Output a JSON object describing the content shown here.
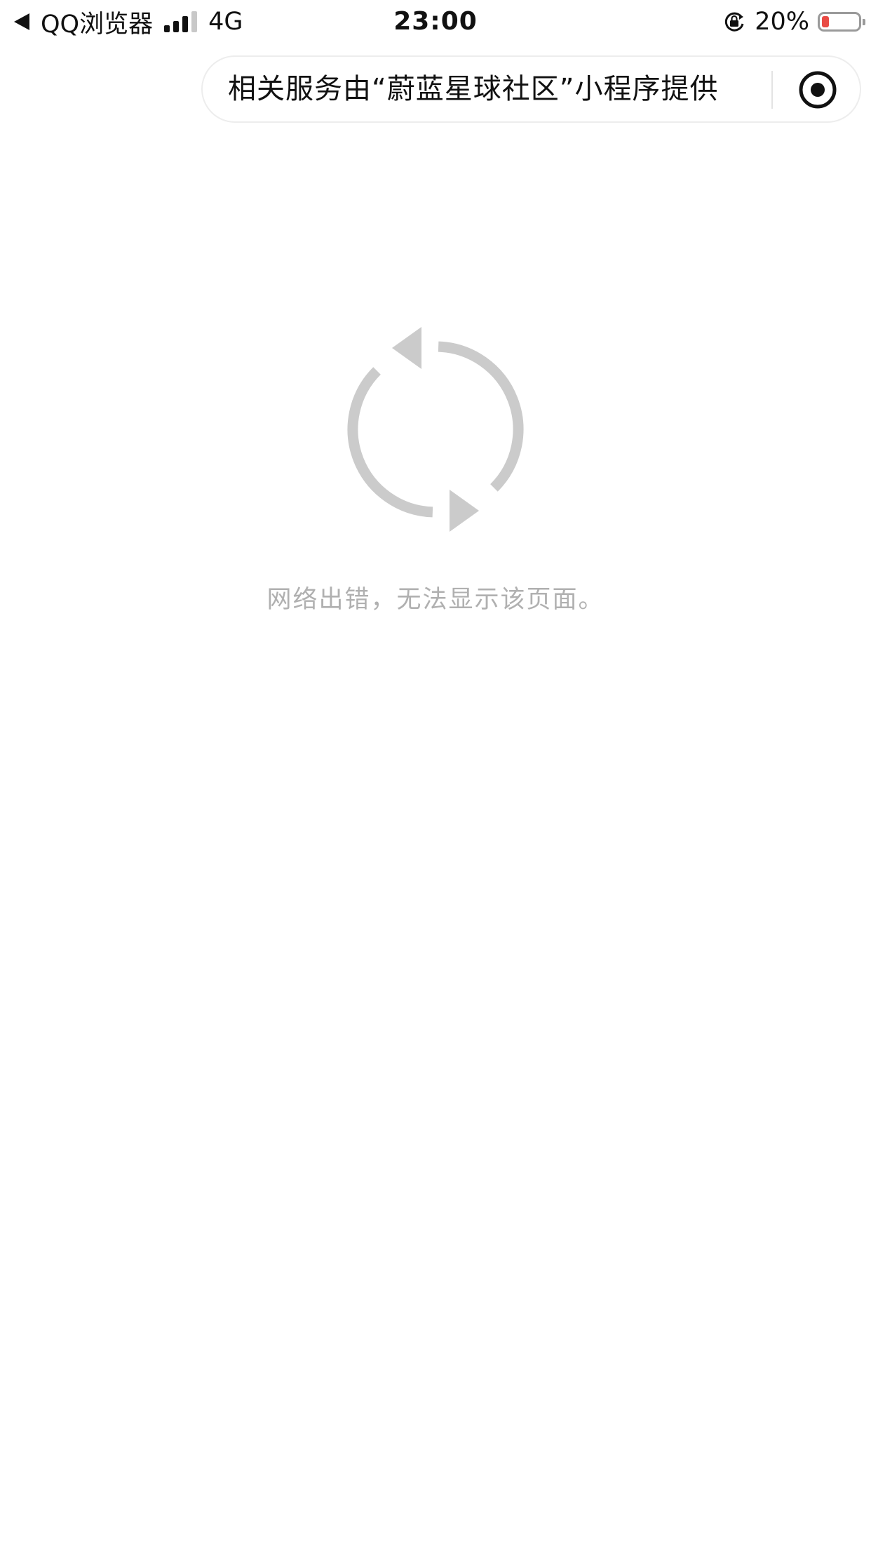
{
  "status_bar": {
    "back_app": "QQ浏览器",
    "network": "4G",
    "time": "23:00",
    "battery_percent_text": "20%",
    "battery_level": 0.2,
    "battery_color": "#e94b45",
    "icons": [
      "back-arrow-icon",
      "signal-icon",
      "rotation-lock-icon",
      "battery-icon"
    ]
  },
  "notice": {
    "text": "相关服务由“蔚蓝星球社区”小程序提供",
    "action_icon": "record-icon"
  },
  "error": {
    "icon": "refresh-icon",
    "message": "网络出错，无法显示该页面。"
  }
}
